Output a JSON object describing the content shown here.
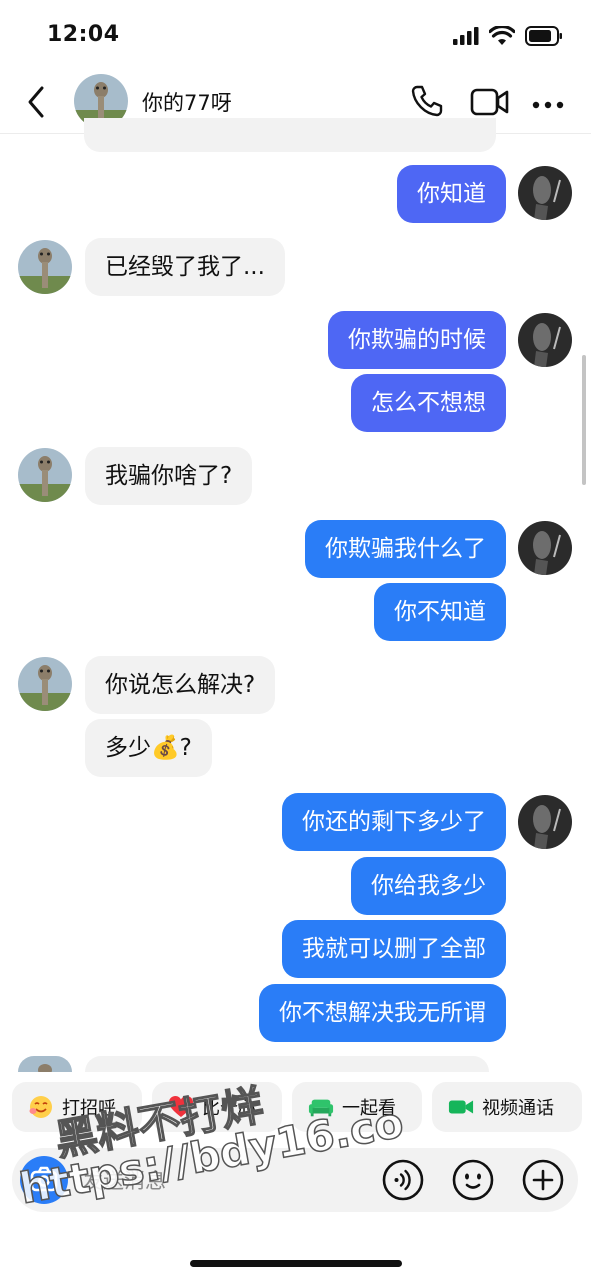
{
  "status_bar": {
    "time": "12:04"
  },
  "header": {
    "contact_name": "你的77呀"
  },
  "messages": [
    {
      "side": "out",
      "text": "你知道"
    },
    {
      "side": "in",
      "text": "已经毁了我了..."
    },
    {
      "side": "out",
      "text": "你欺骗的时候"
    },
    {
      "side": "out",
      "text": "怎么不想想"
    },
    {
      "side": "in",
      "text": "我骗你啥了?"
    },
    {
      "side": "out",
      "text": "你欺骗我什么了"
    },
    {
      "side": "out",
      "text": "你不知道"
    },
    {
      "side": "in",
      "text": "你说怎么解决?"
    },
    {
      "side": "in",
      "text": "多少💰?"
    },
    {
      "side": "out",
      "text": "你还的剩下多少了"
    },
    {
      "side": "out",
      "text": "你给我多少"
    },
    {
      "side": "out",
      "text": "我就可以删了全部"
    },
    {
      "side": "out",
      "text": "你不想解决我无所谓"
    }
  ],
  "quick_actions": [
    {
      "label": "打招呼",
      "icon": "smiley-wave-icon"
    },
    {
      "label": "比个心",
      "icon": "heart-icon"
    },
    {
      "label": "一起看",
      "icon": "sofa-icon"
    },
    {
      "label": "视频通话",
      "icon": "video-camera-icon"
    }
  ],
  "composer": {
    "placeholder": "发送消息"
  },
  "watermark": {
    "line1": "黑料不打烊",
    "line2": "https://bdy16.co"
  },
  "colors": {
    "outgoing_indigo": "#4e67f4",
    "outgoing_blue": "#2a7df7",
    "incoming": "#f2f2f2"
  }
}
